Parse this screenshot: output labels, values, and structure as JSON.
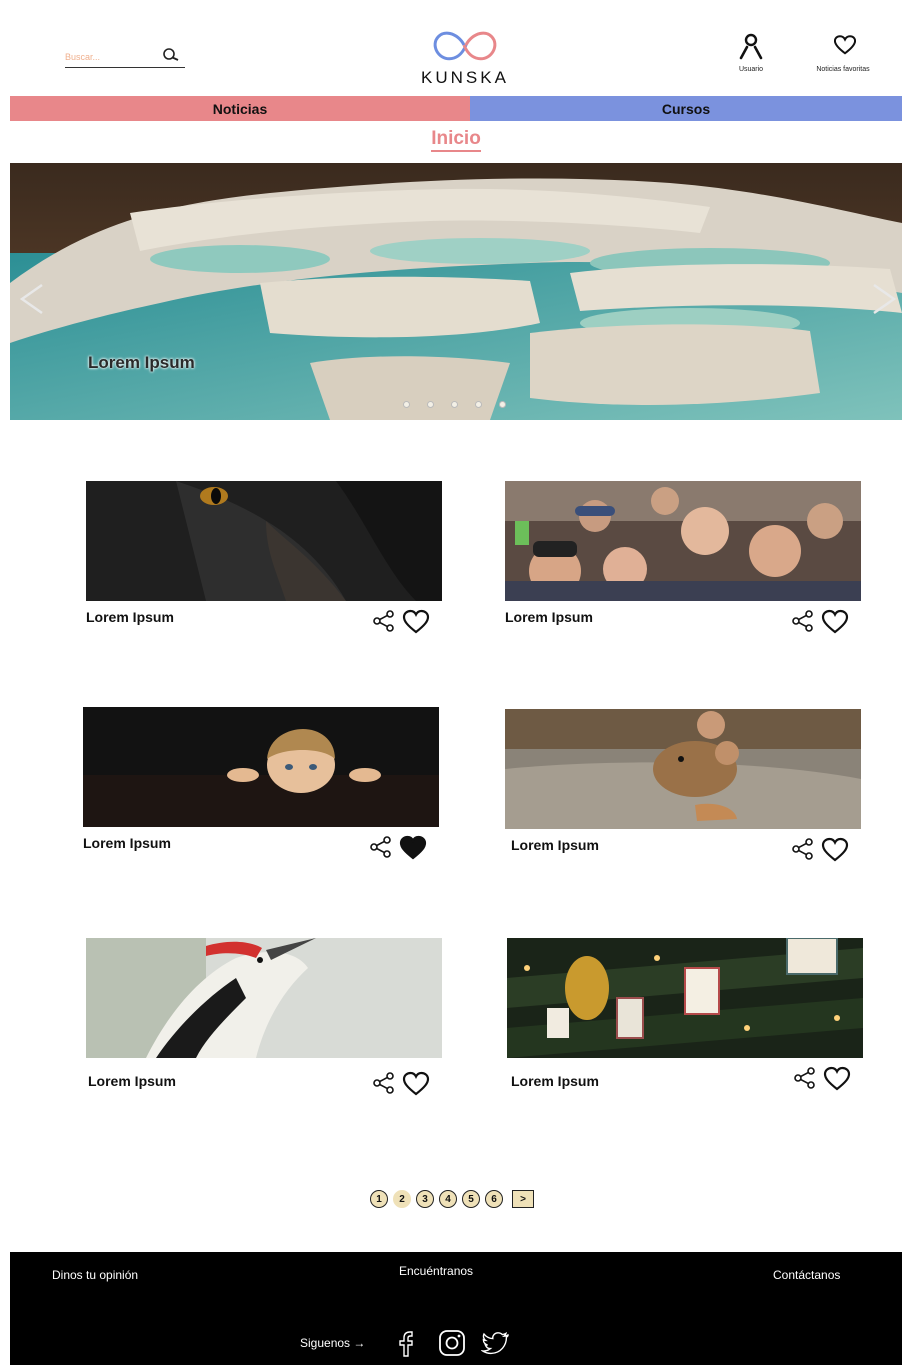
{
  "header": {
    "search_placeholder": "Buscar...",
    "logo_text": "KUNSKA",
    "user_label": "Usuario",
    "favorites_label": "Noticias favoritas"
  },
  "nav": {
    "tabs": [
      {
        "label": "Noticias",
        "color": "#e8878a"
      },
      {
        "label": "Cursos",
        "color": "#7b92de"
      }
    ]
  },
  "page_title": "Inicio",
  "hero": {
    "caption": "Lorem Ipsum",
    "slide_count": 5,
    "active_slide": 1
  },
  "news": [
    {
      "title": "Lorem Ipsum",
      "image": "black-cat",
      "favorited": false
    },
    {
      "title": "Lorem Ipsum",
      "image": "crowd",
      "favorited": false
    },
    {
      "title": "Lorem Ipsum",
      "image": "child-peeking",
      "favorited": true
    },
    {
      "title": "Lorem Ipsum",
      "image": "mouse",
      "favorited": false
    },
    {
      "title": "Lorem Ipsum",
      "image": "woodpecker",
      "favorited": false
    },
    {
      "title": "Lorem Ipsum",
      "image": "christmas-tree",
      "favorited": false
    }
  ],
  "pagination": {
    "pages": [
      "1",
      "2",
      "3",
      "4",
      "5",
      "6"
    ],
    "current": "2",
    "next_label": ">"
  },
  "footer": {
    "opinion": "Dinos tu opinión",
    "find_us": "Encuéntranos",
    "contact": "Contáctanos",
    "follow": "Siguenos →",
    "social": [
      "facebook-icon",
      "instagram-icon",
      "twitter-icon"
    ]
  },
  "colors": {
    "noticias": "#e8878a",
    "cursos": "#7b92de",
    "pagination_bg": "#efe1b8",
    "footer_bg": "#000000"
  }
}
